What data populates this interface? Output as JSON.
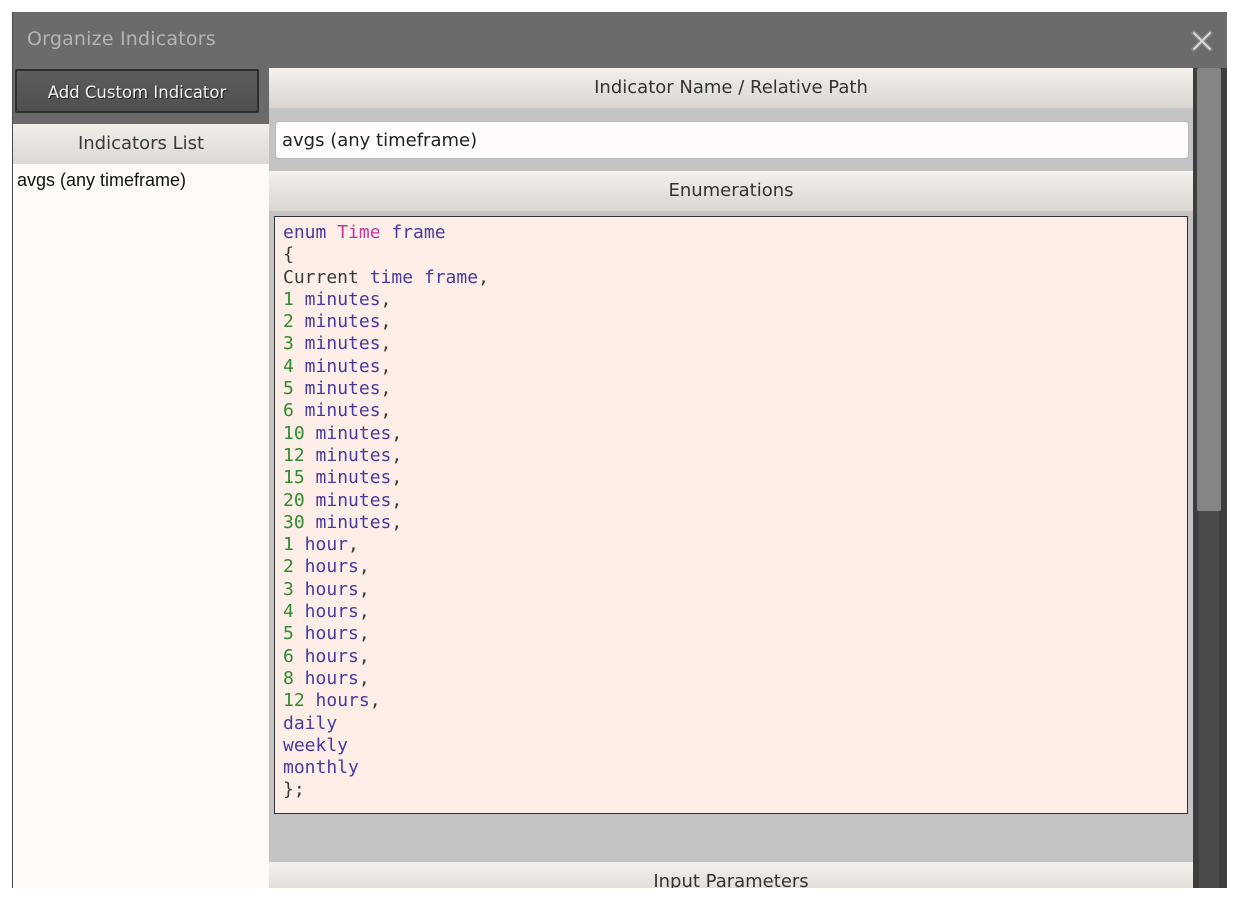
{
  "window": {
    "title": "Organize Indicators"
  },
  "left": {
    "add_button": "Add Custom Indicator",
    "list_header": "Indicators List",
    "items": [
      "avgs (any timeframe)"
    ]
  },
  "right": {
    "name_header": "Indicator Name / Relative Path",
    "name_value": "avgs (any timeframe)",
    "enum_header": "Enumerations",
    "params_header": "Input Parameters",
    "code": [
      [
        [
          "kw",
          "enum "
        ],
        [
          "type",
          "Time"
        ],
        [
          "kw",
          " frame"
        ]
      ],
      [
        [
          "plain",
          "{"
        ]
      ],
      [
        [
          "plain",
          "Current "
        ],
        [
          "kw",
          "time frame"
        ],
        [
          "plain",
          ","
        ]
      ],
      [
        [
          "num",
          "1"
        ],
        [
          "word",
          " minutes"
        ],
        [
          "plain",
          ","
        ]
      ],
      [
        [
          "num",
          "2"
        ],
        [
          "word",
          " minutes"
        ],
        [
          "plain",
          ","
        ]
      ],
      [
        [
          "num",
          "3"
        ],
        [
          "word",
          " minutes"
        ],
        [
          "plain",
          ","
        ]
      ],
      [
        [
          "num",
          "4"
        ],
        [
          "word",
          " minutes"
        ],
        [
          "plain",
          ","
        ]
      ],
      [
        [
          "num",
          "5"
        ],
        [
          "word",
          " minutes"
        ],
        [
          "plain",
          ","
        ]
      ],
      [
        [
          "num",
          "6"
        ],
        [
          "word",
          " minutes"
        ],
        [
          "plain",
          ","
        ]
      ],
      [
        [
          "num",
          "10"
        ],
        [
          "word",
          " minutes"
        ],
        [
          "plain",
          ","
        ]
      ],
      [
        [
          "num",
          "12"
        ],
        [
          "word",
          " minutes"
        ],
        [
          "plain",
          ","
        ]
      ],
      [
        [
          "num",
          "15"
        ],
        [
          "word",
          " minutes"
        ],
        [
          "plain",
          ","
        ]
      ],
      [
        [
          "num",
          "20"
        ],
        [
          "word",
          " minutes"
        ],
        [
          "plain",
          ","
        ]
      ],
      [
        [
          "num",
          "30"
        ],
        [
          "word",
          " minutes"
        ],
        [
          "plain",
          ","
        ]
      ],
      [
        [
          "num",
          "1"
        ],
        [
          "word",
          " hour"
        ],
        [
          "plain",
          ","
        ]
      ],
      [
        [
          "num",
          "2"
        ],
        [
          "word",
          " hours"
        ],
        [
          "plain",
          ","
        ]
      ],
      [
        [
          "num",
          "3"
        ],
        [
          "word",
          " hours"
        ],
        [
          "plain",
          ","
        ]
      ],
      [
        [
          "num",
          "4"
        ],
        [
          "word",
          " hours"
        ],
        [
          "plain",
          ","
        ]
      ],
      [
        [
          "num",
          "5"
        ],
        [
          "word",
          " hours"
        ],
        [
          "plain",
          ","
        ]
      ],
      [
        [
          "num",
          "6"
        ],
        [
          "word",
          " hours"
        ],
        [
          "plain",
          ","
        ]
      ],
      [
        [
          "num",
          "8"
        ],
        [
          "word",
          " hours"
        ],
        [
          "plain",
          ","
        ]
      ],
      [
        [
          "num",
          "12"
        ],
        [
          "word",
          " hours"
        ],
        [
          "plain",
          ","
        ]
      ],
      [
        [
          "word",
          "daily"
        ]
      ],
      [
        [
          "word",
          "weekly"
        ]
      ],
      [
        [
          "word",
          "monthly"
        ]
      ],
      [
        [
          "plain",
          "};"
        ]
      ]
    ]
  },
  "icons": {
    "close": "close-icon"
  },
  "colors": {
    "title_bar": "#6b6b6b",
    "editor_bg": "#fdeee7",
    "keyword": "#4a3aa0",
    "type": "#c03aa0",
    "number": "#2e8b2e"
  },
  "scroll": {
    "thumb_fraction": 0.54
  }
}
